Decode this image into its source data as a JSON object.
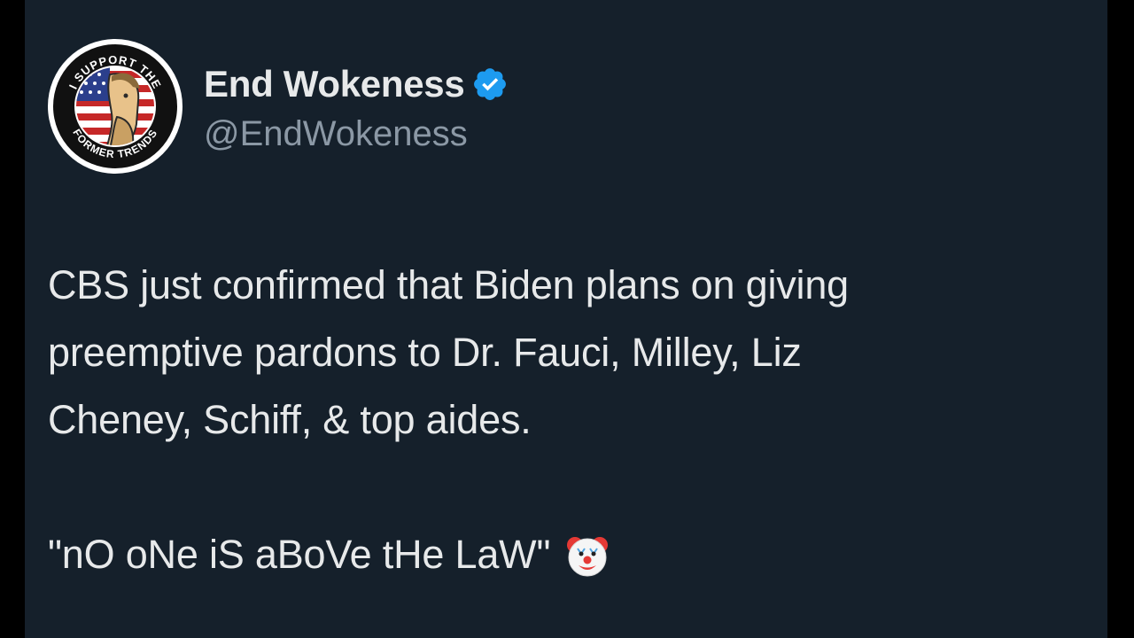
{
  "account": {
    "display_name": "End Wokeness",
    "handle": "@EndWokeness",
    "avatar_text_top": "I SUPPORT THE",
    "avatar_text_bottom": "FORMER TRENDS",
    "verified_icon": "verified-badge-icon",
    "verified_color": "#1d9bf0"
  },
  "tweet": {
    "lines": [
      "CBS just confirmed that Biden plans on giving",
      "preemptive pardons to Dr. Fauci, Milley, Liz",
      "Cheney, Schiff, & top aides."
    ],
    "quote": "\"nO oNe iS aBoVe tHe LaW\"",
    "emoji_icon": "clown-face-icon"
  },
  "theme": {
    "background": "#15202b",
    "text_primary": "#e7e9ea",
    "text_secondary": "#8b98a5"
  }
}
